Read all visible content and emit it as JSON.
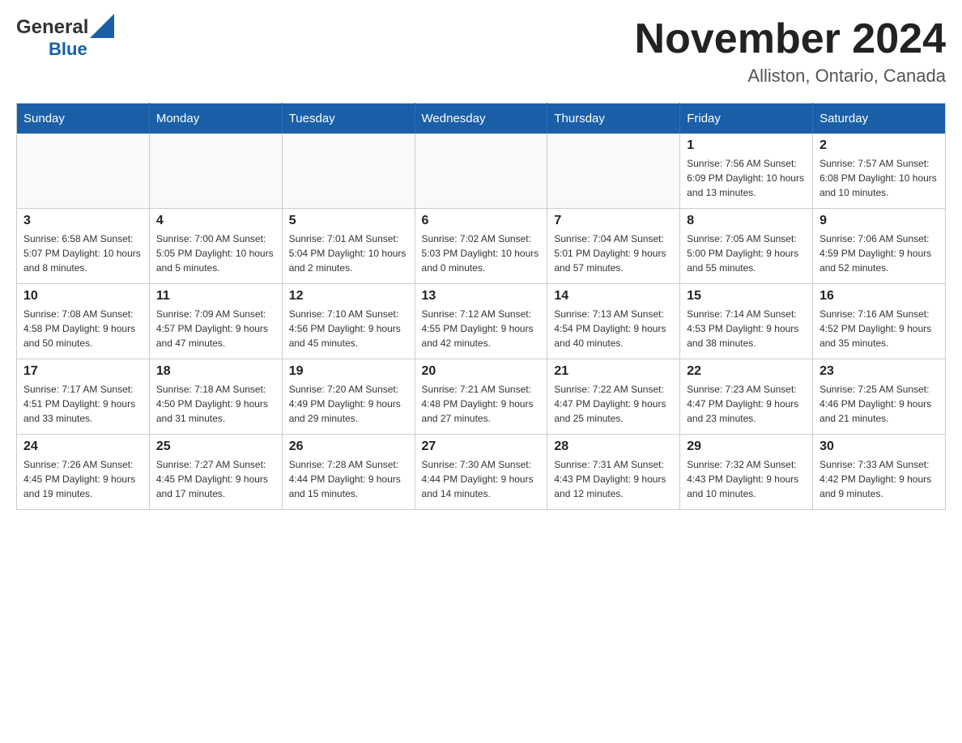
{
  "header": {
    "logo": {
      "general": "General",
      "blue": "Blue"
    },
    "title": "November 2024",
    "location": "Alliston, Ontario, Canada"
  },
  "days_of_week": [
    "Sunday",
    "Monday",
    "Tuesday",
    "Wednesday",
    "Thursday",
    "Friday",
    "Saturday"
  ],
  "weeks": [
    {
      "days": [
        {
          "number": "",
          "info": ""
        },
        {
          "number": "",
          "info": ""
        },
        {
          "number": "",
          "info": ""
        },
        {
          "number": "",
          "info": ""
        },
        {
          "number": "",
          "info": ""
        },
        {
          "number": "1",
          "info": "Sunrise: 7:56 AM\nSunset: 6:09 PM\nDaylight: 10 hours\nand 13 minutes."
        },
        {
          "number": "2",
          "info": "Sunrise: 7:57 AM\nSunset: 6:08 PM\nDaylight: 10 hours\nand 10 minutes."
        }
      ]
    },
    {
      "days": [
        {
          "number": "3",
          "info": "Sunrise: 6:58 AM\nSunset: 5:07 PM\nDaylight: 10 hours\nand 8 minutes."
        },
        {
          "number": "4",
          "info": "Sunrise: 7:00 AM\nSunset: 5:05 PM\nDaylight: 10 hours\nand 5 minutes."
        },
        {
          "number": "5",
          "info": "Sunrise: 7:01 AM\nSunset: 5:04 PM\nDaylight: 10 hours\nand 2 minutes."
        },
        {
          "number": "6",
          "info": "Sunrise: 7:02 AM\nSunset: 5:03 PM\nDaylight: 10 hours\nand 0 minutes."
        },
        {
          "number": "7",
          "info": "Sunrise: 7:04 AM\nSunset: 5:01 PM\nDaylight: 9 hours\nand 57 minutes."
        },
        {
          "number": "8",
          "info": "Sunrise: 7:05 AM\nSunset: 5:00 PM\nDaylight: 9 hours\nand 55 minutes."
        },
        {
          "number": "9",
          "info": "Sunrise: 7:06 AM\nSunset: 4:59 PM\nDaylight: 9 hours\nand 52 minutes."
        }
      ]
    },
    {
      "days": [
        {
          "number": "10",
          "info": "Sunrise: 7:08 AM\nSunset: 4:58 PM\nDaylight: 9 hours\nand 50 minutes."
        },
        {
          "number": "11",
          "info": "Sunrise: 7:09 AM\nSunset: 4:57 PM\nDaylight: 9 hours\nand 47 minutes."
        },
        {
          "number": "12",
          "info": "Sunrise: 7:10 AM\nSunset: 4:56 PM\nDaylight: 9 hours\nand 45 minutes."
        },
        {
          "number": "13",
          "info": "Sunrise: 7:12 AM\nSunset: 4:55 PM\nDaylight: 9 hours\nand 42 minutes."
        },
        {
          "number": "14",
          "info": "Sunrise: 7:13 AM\nSunset: 4:54 PM\nDaylight: 9 hours\nand 40 minutes."
        },
        {
          "number": "15",
          "info": "Sunrise: 7:14 AM\nSunset: 4:53 PM\nDaylight: 9 hours\nand 38 minutes."
        },
        {
          "number": "16",
          "info": "Sunrise: 7:16 AM\nSunset: 4:52 PM\nDaylight: 9 hours\nand 35 minutes."
        }
      ]
    },
    {
      "days": [
        {
          "number": "17",
          "info": "Sunrise: 7:17 AM\nSunset: 4:51 PM\nDaylight: 9 hours\nand 33 minutes."
        },
        {
          "number": "18",
          "info": "Sunrise: 7:18 AM\nSunset: 4:50 PM\nDaylight: 9 hours\nand 31 minutes."
        },
        {
          "number": "19",
          "info": "Sunrise: 7:20 AM\nSunset: 4:49 PM\nDaylight: 9 hours\nand 29 minutes."
        },
        {
          "number": "20",
          "info": "Sunrise: 7:21 AM\nSunset: 4:48 PM\nDaylight: 9 hours\nand 27 minutes."
        },
        {
          "number": "21",
          "info": "Sunrise: 7:22 AM\nSunset: 4:47 PM\nDaylight: 9 hours\nand 25 minutes."
        },
        {
          "number": "22",
          "info": "Sunrise: 7:23 AM\nSunset: 4:47 PM\nDaylight: 9 hours\nand 23 minutes."
        },
        {
          "number": "23",
          "info": "Sunrise: 7:25 AM\nSunset: 4:46 PM\nDaylight: 9 hours\nand 21 minutes."
        }
      ]
    },
    {
      "days": [
        {
          "number": "24",
          "info": "Sunrise: 7:26 AM\nSunset: 4:45 PM\nDaylight: 9 hours\nand 19 minutes."
        },
        {
          "number": "25",
          "info": "Sunrise: 7:27 AM\nSunset: 4:45 PM\nDaylight: 9 hours\nand 17 minutes."
        },
        {
          "number": "26",
          "info": "Sunrise: 7:28 AM\nSunset: 4:44 PM\nDaylight: 9 hours\nand 15 minutes."
        },
        {
          "number": "27",
          "info": "Sunrise: 7:30 AM\nSunset: 4:44 PM\nDaylight: 9 hours\nand 14 minutes."
        },
        {
          "number": "28",
          "info": "Sunrise: 7:31 AM\nSunset: 4:43 PM\nDaylight: 9 hours\nand 12 minutes."
        },
        {
          "number": "29",
          "info": "Sunrise: 7:32 AM\nSunset: 4:43 PM\nDaylight: 9 hours\nand 10 minutes."
        },
        {
          "number": "30",
          "info": "Sunrise: 7:33 AM\nSunset: 4:42 PM\nDaylight: 9 hours\nand 9 minutes."
        }
      ]
    }
  ]
}
